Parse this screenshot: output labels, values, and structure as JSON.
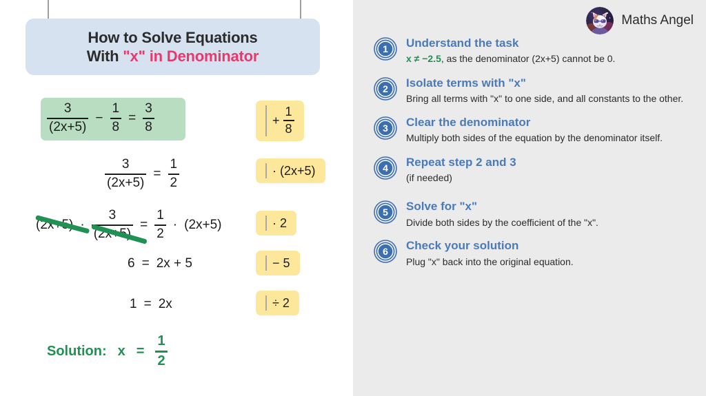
{
  "brand": {
    "name": "Maths Angel",
    "avatar_icon": "cat-astronaut-avatar-icon"
  },
  "title": {
    "line1": "How to Solve Equations",
    "line2_prefix": "With ",
    "line2_accent": "\"x\" in Denominator"
  },
  "colors": {
    "accent_pink": "#e8386d",
    "step_blue": "#4a7ab8",
    "badge_blue": "#3c6fb0",
    "green": "#1f9152",
    "highlight_green": "#b8ddc0",
    "chip_yellow": "#fce79a",
    "banner_blue": "#d6e2f0",
    "panel_gray": "#ebebeb"
  },
  "equations": [
    {
      "id": "eq-1",
      "highlighted": true,
      "parts": [
        {
          "type": "frac",
          "num": "3",
          "den": "(2x+5)"
        },
        {
          "type": "op",
          "text": "−"
        },
        {
          "type": "frac",
          "num": "1",
          "den": "8"
        },
        {
          "type": "op",
          "text": "="
        },
        {
          "type": "frac",
          "num": "3",
          "den": "8"
        }
      ]
    },
    {
      "id": "eq-2",
      "highlighted": false,
      "parts": [
        {
          "type": "frac",
          "num": "3",
          "den": "(2x+5)"
        },
        {
          "type": "op",
          "text": "="
        },
        {
          "type": "frac",
          "num": "1",
          "den": "2"
        }
      ]
    },
    {
      "id": "eq-3",
      "highlighted": false,
      "struck": true,
      "parts": [
        {
          "type": "text",
          "text": "(2x+5)"
        },
        {
          "type": "op",
          "text": "·"
        },
        {
          "type": "frac",
          "num": "3",
          "den": "(2x+5)"
        },
        {
          "type": "op",
          "text": "="
        },
        {
          "type": "frac",
          "num": "1",
          "den": "2"
        },
        {
          "type": "op",
          "text": "·"
        },
        {
          "type": "text",
          "text": "(2x+5)"
        }
      ]
    },
    {
      "id": "eq-4",
      "highlighted": false,
      "parts": [
        {
          "type": "text",
          "text": "6"
        },
        {
          "type": "op",
          "text": "="
        },
        {
          "type": "text",
          "text": "2x + 5"
        }
      ]
    },
    {
      "id": "eq-5",
      "highlighted": false,
      "parts": [
        {
          "type": "text",
          "text": "1"
        },
        {
          "type": "op",
          "text": "="
        },
        {
          "type": "text",
          "text": "2x"
        }
      ]
    }
  ],
  "operation_chips": [
    {
      "id": "chip-1",
      "op": "+",
      "operand_type": "frac",
      "num": "1",
      "den": "8"
    },
    {
      "id": "chip-2",
      "op": "·",
      "operand_type": "text",
      "operand": "(2x+5)"
    },
    {
      "id": "chip-3",
      "op": "·",
      "operand_type": "text",
      "operand": "2"
    },
    {
      "id": "chip-4",
      "op": "−",
      "operand_type": "text",
      "operand": "5"
    },
    {
      "id": "chip-5",
      "op": "÷",
      "operand_type": "text",
      "operand": "2"
    }
  ],
  "solution": {
    "label": "Solution:",
    "variable": "x",
    "equals": "=",
    "num": "1",
    "den": "2"
  },
  "steps": [
    {
      "number": "1",
      "title": "Understand the task",
      "desc_highlight": "x ≠ −2.5",
      "desc_rest": ", as the denominator (2x+5) cannot be 0."
    },
    {
      "number": "2",
      "title": "Isolate terms with \"x\"",
      "desc_highlight": "",
      "desc_rest": "Bring all terms with \"x\" to one side, and all constants to the other."
    },
    {
      "number": "3",
      "title": "Clear the denominator",
      "desc_highlight": "",
      "desc_rest": "Multiply both sides of the equation by the denominator itself."
    },
    {
      "number": "4",
      "title": "Repeat step 2 and 3",
      "desc_highlight": "",
      "desc_rest": "(if needed)"
    },
    {
      "number": "5",
      "title": "Solve for \"x\"",
      "desc_highlight": "",
      "desc_rest": "Divide both sides by the coefficient of the \"x\"."
    },
    {
      "number": "6",
      "title": "Check your solution",
      "desc_highlight": "",
      "desc_rest": "Plug \"x\" back into the original equation."
    }
  ]
}
